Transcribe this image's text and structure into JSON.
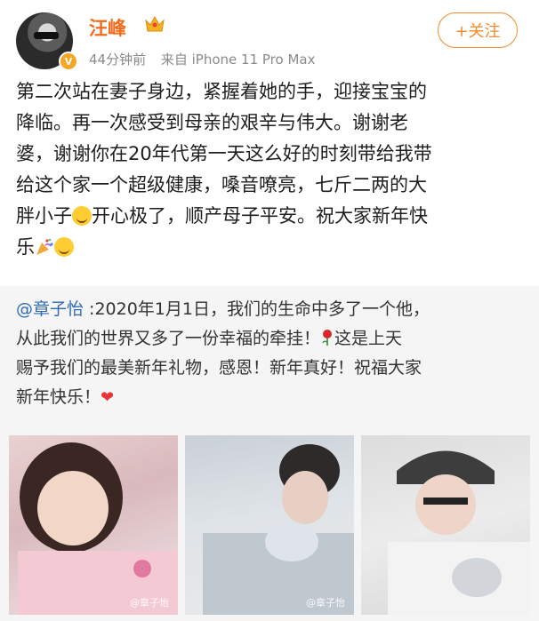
{
  "user": {
    "name": "汪峰",
    "time": "44分钟前",
    "source": "来自 iPhone 11 Pro Max",
    "follow_label": "+关注",
    "verified_badge": "V"
  },
  "post": {
    "line1": "第二次站在妻子身边，紧握着她的手，迎接宝宝的",
    "line2": "降临。再一次感受到母亲的艰辛与伟大。谢谢老",
    "line3": "婆，谢谢你在20年代第一天这么好的时刻带给我带",
    "line4": "给这个家一个超级健康，嗓音嘹亮，七斤二两的大",
    "line5a": "胖小子",
    "line5b": "开心极了，顺产母子平安。祝大家新年快",
    "line6": "乐"
  },
  "repost": {
    "mention": "@章子怡",
    "line1": " :2020年1月1日，我们的生命中多了一个他，",
    "line2a": "从此我们的世界又多了一份幸福的牵挂！",
    "line2b": "这是上天",
    "line3": "赐予我们的最美新年礼物，感恩！新年真好！祝福大家",
    "line4": "新年快乐！",
    "heart": "❤"
  },
  "photos": {
    "watermark1": "@章子怡",
    "watermark2": "@章子怡"
  },
  "colors": {
    "username": "#f26b1d",
    "follow": "#f28b2a",
    "mention": "#2f6ab0",
    "repost_bg": "#f5f5f5"
  }
}
